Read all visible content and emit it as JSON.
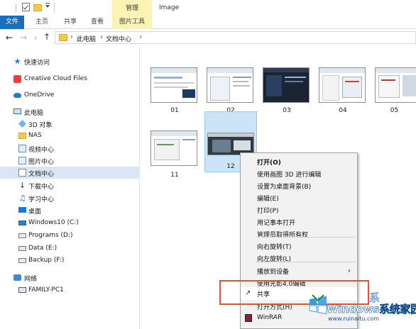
{
  "titlebar": {
    "manage_tab": "管理",
    "window_title": "Image"
  },
  "ribbon": {
    "tabs": [
      "文件",
      "主页",
      "共享",
      "查看",
      "图片工具"
    ]
  },
  "address": {
    "crumbs": [
      "此电脑",
      "文档中心"
    ]
  },
  "nav_pane": {
    "quick_access": "快速访问",
    "creative_cloud": "Creative Cloud Files",
    "onedrive": "OneDrive",
    "this_pc": "此电脑",
    "pc_items": [
      "3D 对象",
      "NAS",
      "视频中心",
      "图片中心",
      "文档中心",
      "下载中心",
      "学习中心",
      "桌面"
    ],
    "drives": [
      "Windows10 (C:)",
      "Programs (D:)",
      "Data (E:)",
      "Backup (F:)"
    ],
    "network": "网络",
    "network_host": "FAMILY-PC1"
  },
  "files": [
    {
      "name": "01"
    },
    {
      "name": "02"
    },
    {
      "name": "03"
    },
    {
      "name": "04"
    },
    {
      "name": "05"
    },
    {
      "name": "11"
    },
    {
      "name": "12",
      "selected": true
    }
  ],
  "context_menu": {
    "items": [
      "打开(O)",
      "使用画图 3D 进行编辑",
      "设置为桌面背景(B)",
      "编辑(E)",
      "打印(P)",
      "用记事本打开",
      "管理员取得所有权",
      "向右旋转(T)",
      "向左旋转(L)",
      "播放到设备",
      "使用光影4.0编辑",
      "共享",
      "打开方式(H)",
      "WinRAR"
    ]
  },
  "watermark": {
    "brand": "Windows系统家园",
    "url": "www.ruinaitu.com",
    "top_glyph": "系"
  },
  "colors": {
    "accent": "#1a6fbd",
    "picture_tools_tab": "#faf3b5",
    "selection": "#cce4f7",
    "highlight_box": "#e4552e"
  }
}
